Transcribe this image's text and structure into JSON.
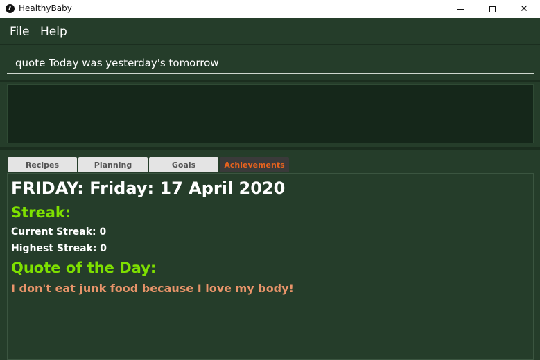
{
  "window": {
    "title": "HealthyBaby",
    "icon": "app-logo-icon",
    "controls": [
      "minimize-icon",
      "maximize-icon",
      "close-icon"
    ]
  },
  "menu": {
    "file_label": "File",
    "help_label": "Help"
  },
  "command": {
    "value": "quote Today was yesterday's tomorrow"
  },
  "result": {
    "text": ""
  },
  "tabs": [
    {
      "label": "Recipes"
    },
    {
      "label": "Planning"
    },
    {
      "label": "Goals"
    },
    {
      "label": "Achievements",
      "selected": true
    }
  ],
  "achievements": {
    "date_heading": "FRIDAY: Friday: 17 April 2020",
    "streak_heading": "Streak:",
    "current_streak": "Current Streak: 0",
    "highest_streak": "Highest Streak: 0",
    "quote_heading": "Quote of the Day:",
    "quote_text": "I don't eat junk food because I love my body!"
  },
  "colors": {
    "background": "#253d2a",
    "heading_green": "#7ee000",
    "quote_orange": "#e8946a",
    "active_tab_text": "#e8631e"
  }
}
